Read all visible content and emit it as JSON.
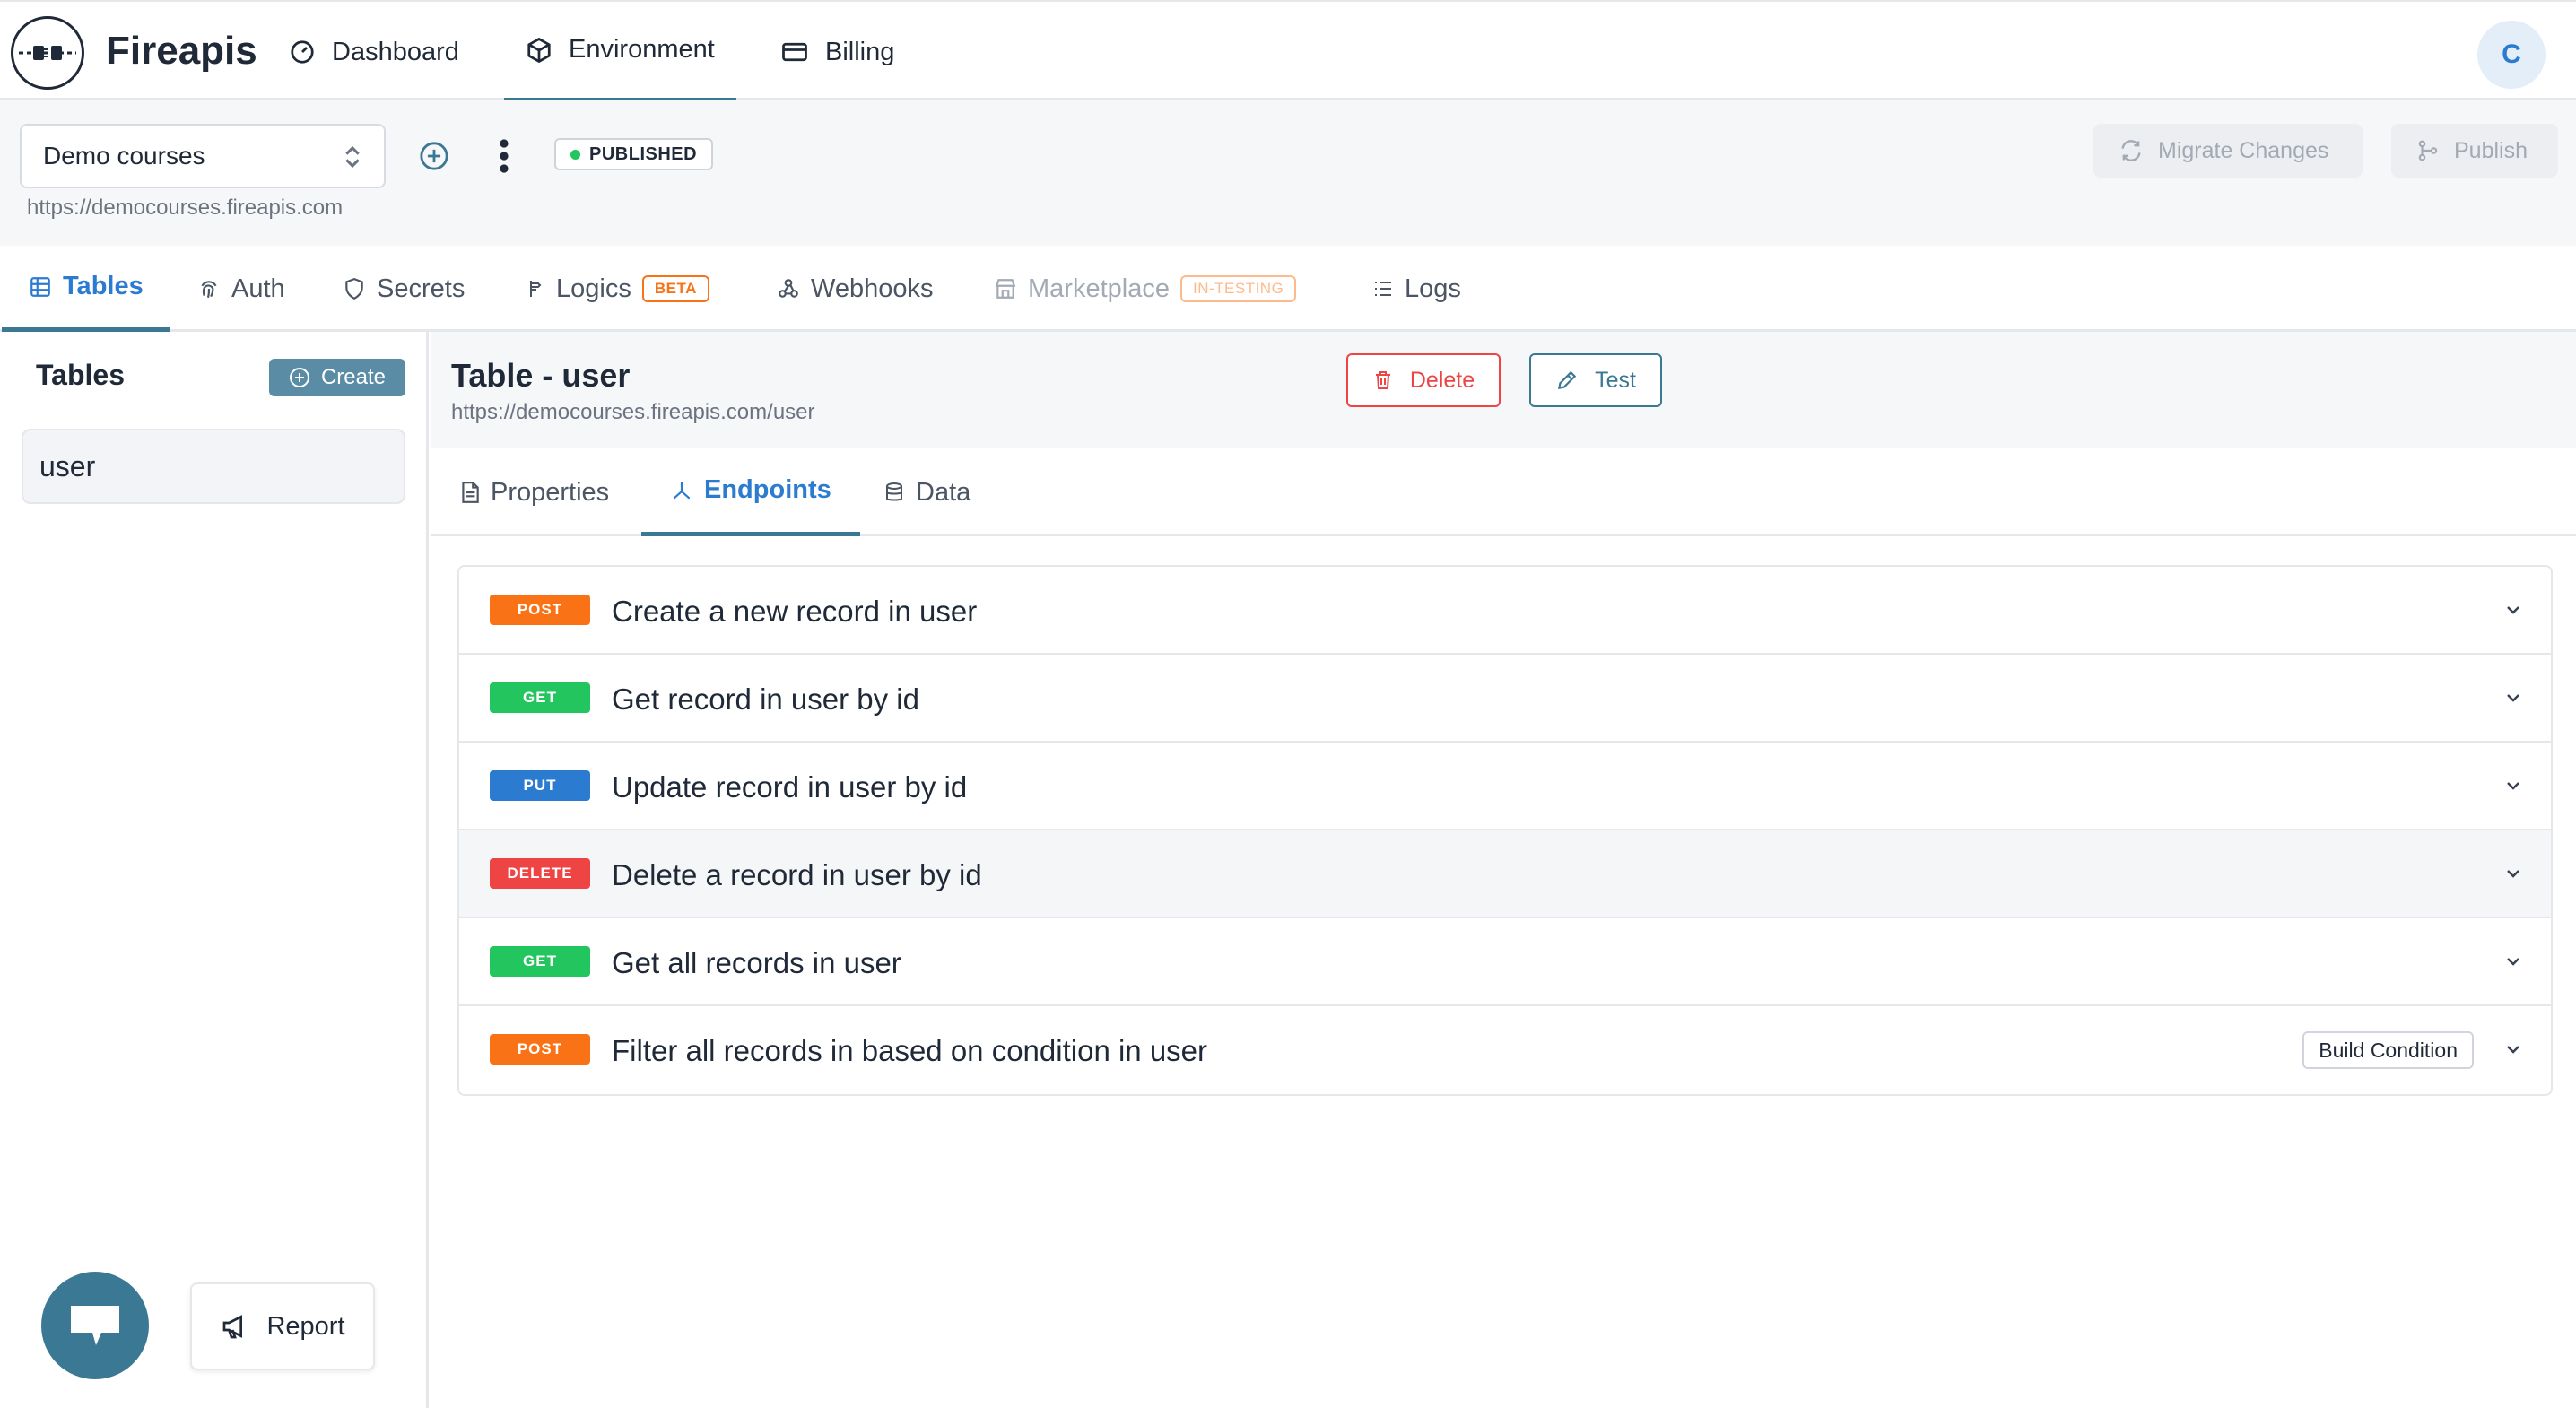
{
  "app": {
    "name": "Fireapis",
    "avatar_initial": "C"
  },
  "topnav": {
    "items": [
      {
        "label": "Dashboard",
        "icon": "gauge-icon"
      },
      {
        "label": "Environment",
        "icon": "cube-icon",
        "active": true
      },
      {
        "label": "Billing",
        "icon": "card-icon"
      }
    ]
  },
  "environment": {
    "selected": "Demo courses",
    "url": "https://democourses.fireapis.com",
    "status": "PUBLISHED",
    "migrate_label": "Migrate Changes",
    "publish_label": "Publish"
  },
  "main_tabs": [
    {
      "label": "Tables",
      "icon": "table-icon",
      "active": true
    },
    {
      "label": "Auth",
      "icon": "fingerprint-icon"
    },
    {
      "label": "Secrets",
      "icon": "shield-icon"
    },
    {
      "label": "Logics",
      "icon": "logic-icon",
      "tag": "BETA"
    },
    {
      "label": "Webhooks",
      "icon": "webhook-icon"
    },
    {
      "label": "Marketplace",
      "icon": "store-icon",
      "tag": "IN-TESTING",
      "disabled": true
    },
    {
      "label": "Logs",
      "icon": "list-icon"
    }
  ],
  "sidebar": {
    "title": "Tables",
    "create_label": "Create",
    "tables": [
      "user"
    ],
    "report_label": "Report"
  },
  "table": {
    "title": "Table - user",
    "url": "https://democourses.fireapis.com/user",
    "delete_label": "Delete",
    "test_label": "Test",
    "tabs": [
      {
        "label": "Properties",
        "icon": "file-icon"
      },
      {
        "label": "Endpoints",
        "icon": "endpoint-icon",
        "active": true
      },
      {
        "label": "Data",
        "icon": "database-icon"
      }
    ]
  },
  "endpoints": [
    {
      "method": "POST",
      "label": "Create a new record in user"
    },
    {
      "method": "GET",
      "label": "Get record in user by id"
    },
    {
      "method": "PUT",
      "label": "Update record in user by id"
    },
    {
      "method": "DELETE",
      "label": "Delete a record in user by id"
    },
    {
      "method": "GET",
      "label": "Get all records in user"
    },
    {
      "method": "POST",
      "label": "Filter all records in based on condition in user",
      "action": "Build Condition"
    }
  ],
  "colors": {
    "accent": "#3b7894",
    "link": "#2b7bd0",
    "post": "#f97316",
    "get": "#22c55e",
    "put": "#2b7bd0",
    "delete": "#ef4444"
  }
}
